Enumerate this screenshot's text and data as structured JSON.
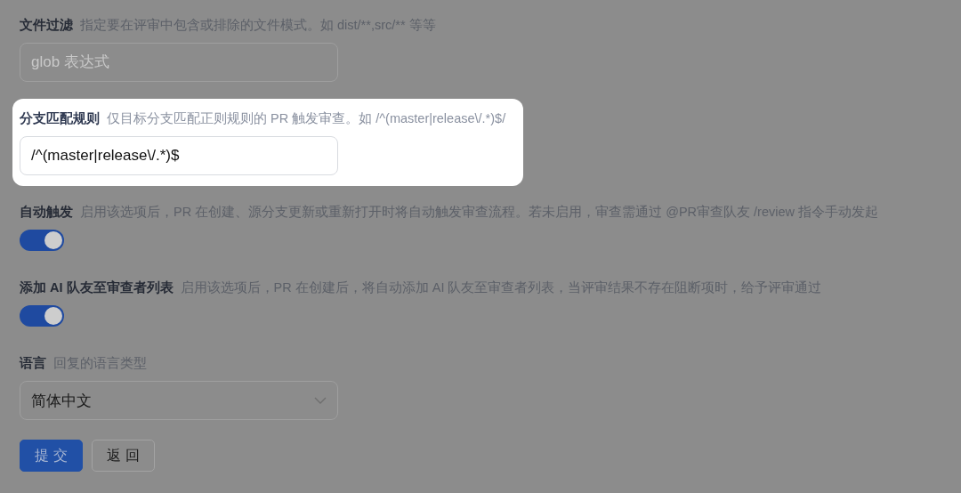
{
  "fields": [
    {
      "kind": "text",
      "label": "文件过滤",
      "description": "指定要在评审中包含或排除的文件模式。如 dist/**,src/** 等等",
      "placeholder": "glob 表达式",
      "highlighted": false
    },
    {
      "kind": "text",
      "label": "分支匹配规则",
      "description": "仅目标分支匹配正则规则的 PR 触发审查。如 /^(master|release\\/.*)$/",
      "value": "/^(master|release\\/.*)$",
      "highlighted": true
    },
    {
      "kind": "toggle",
      "label": "自动触发",
      "description": "启用该选项后，PR 在创建、源分支更新或重新打开时将自动触发审查流程。若未启用，审查需通过 @PR审查队友 /review 指令手动发起",
      "on": true,
      "highlighted": false
    },
    {
      "kind": "toggle",
      "label": "添加 AI 队友至审查者列表",
      "description": "启用该选项后，PR 在创建后，将自动添加 AI 队友至审查者列表，当评审结果不存在阻断项时，给予评审通过",
      "on": true,
      "highlighted": false
    },
    {
      "kind": "select",
      "label": "语言",
      "description": "回复的语言类型",
      "value": "简体中文",
      "highlighted": false
    }
  ],
  "buttons": [
    {
      "label": "提 交",
      "kind": "primary"
    },
    {
      "label": "返 回",
      "kind": "secondary"
    }
  ]
}
